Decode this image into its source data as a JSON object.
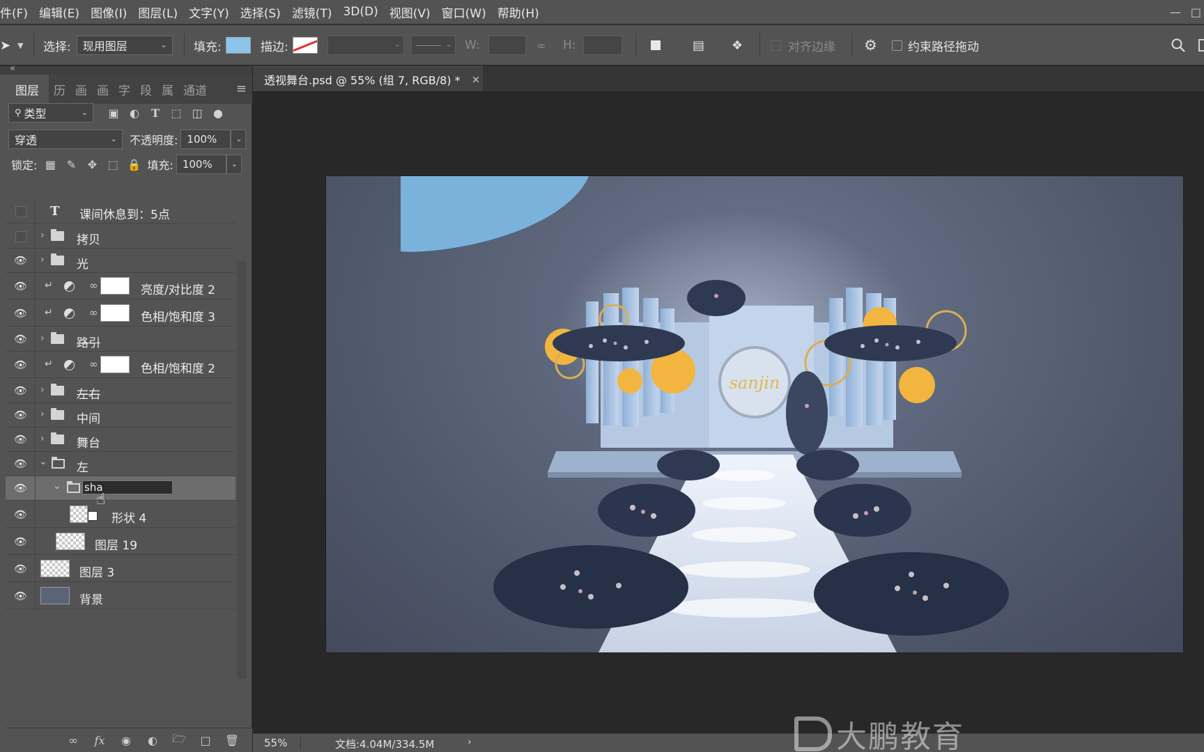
{
  "menu": {
    "items": [
      "文件(F)",
      "编辑(E)",
      "图像(I)",
      "图层(L)",
      "文字(Y)",
      "选择(S)",
      "滤镜(T)",
      "3D(D)",
      "视图(V)",
      "窗口(W)",
      "帮助(H)"
    ],
    "first_visible": "件(F)"
  },
  "options": {
    "select_label": "选择:",
    "select_value": "现用图层",
    "fill_label": "填充:",
    "stroke_label": "描边:",
    "w_label": "W:",
    "h_label": "H:",
    "align_edges": "对齐边缘",
    "constrain_path": "约束路径拖动",
    "fill_color": "#8cc4ec",
    "stroke_color": "#e03030"
  },
  "panel": {
    "tabs": [
      "图层",
      "历",
      "画",
      "画",
      "字",
      "段",
      "属",
      "通道"
    ],
    "filter_value": "类型",
    "blend_mode": "穿透",
    "opacity_label": "不透明度:",
    "opacity_value": "100%",
    "lock_label": "锁定:",
    "fill_label": "填充:",
    "fill_value": "100%"
  },
  "layers": [
    {
      "name": "课间休息到：5点",
      "kind": "text",
      "visible": false
    },
    {
      "name": "拷贝",
      "kind": "group",
      "visible": false
    },
    {
      "name": "光",
      "kind": "group",
      "visible": true
    },
    {
      "name": "亮度/对比度 2",
      "kind": "adjustment",
      "visible": true
    },
    {
      "name": "色相/饱和度 3",
      "kind": "adjustment",
      "visible": true
    },
    {
      "name": "路引",
      "kind": "group",
      "visible": true
    },
    {
      "name": "色相/饱和度 2",
      "kind": "adjustment",
      "visible": true
    },
    {
      "name": "左右",
      "kind": "group",
      "visible": true
    },
    {
      "name": "中间",
      "kind": "group",
      "visible": true
    },
    {
      "name": "舞台",
      "kind": "group",
      "visible": true
    },
    {
      "name": "左",
      "kind": "group-open",
      "visible": true
    },
    {
      "name": "sha",
      "kind": "group-rename",
      "visible": true
    },
    {
      "name": "形状 4",
      "kind": "shape",
      "visible": true
    },
    {
      "name": "图层 19",
      "kind": "pixel",
      "visible": true
    },
    {
      "name": "图层 3",
      "kind": "pixel",
      "visible": true
    },
    {
      "name": "背景",
      "kind": "background",
      "visible": true
    }
  ],
  "document": {
    "tab_title": "透视舞台.psd @ 55% (组 7, RGB/8) *",
    "close": "×",
    "stage_sign": "sanjin"
  },
  "status": {
    "zoom": "55%",
    "doc_size": "文档:4.04M/334.5M"
  },
  "watermark": {
    "text": "大鹏教育"
  },
  "colors": {
    "chrome": "#535353",
    "workspace": "#282828",
    "canvas_bg": "#5b6479",
    "stage_blue": "#a9c3e0",
    "accent_gold": "#f2b540"
  }
}
